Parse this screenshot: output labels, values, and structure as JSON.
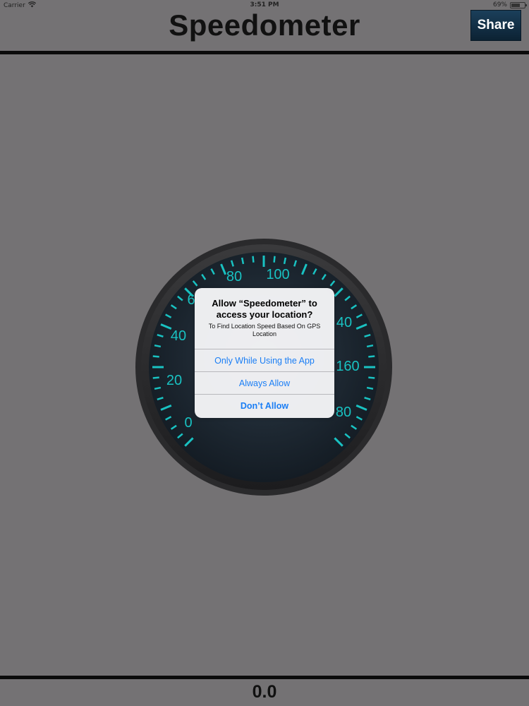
{
  "status_bar": {
    "carrier": "Carrier",
    "time": "3:51 PM",
    "battery": "69%",
    "battery_level": 0.69
  },
  "nav": {
    "title": "Speedometer",
    "share_label": "Share"
  },
  "gauge": {
    "visible_labels": [
      "0",
      "20",
      "40",
      "6",
      "80",
      "100",
      "40",
      "160",
      "80"
    ],
    "accent_color": "#19c2c2",
    "face_color": "#1e2a35"
  },
  "alert": {
    "title": "Allow “Speedometer” to access your location?",
    "message": "To Find Location Speed Based On GPS Location",
    "actions": [
      {
        "label": "Only While Using the App"
      },
      {
        "label": "Always Allow"
      },
      {
        "label": "Don’t Allow"
      }
    ],
    "action_color": "#1a7ef5"
  },
  "speed": {
    "value": "0.0"
  }
}
